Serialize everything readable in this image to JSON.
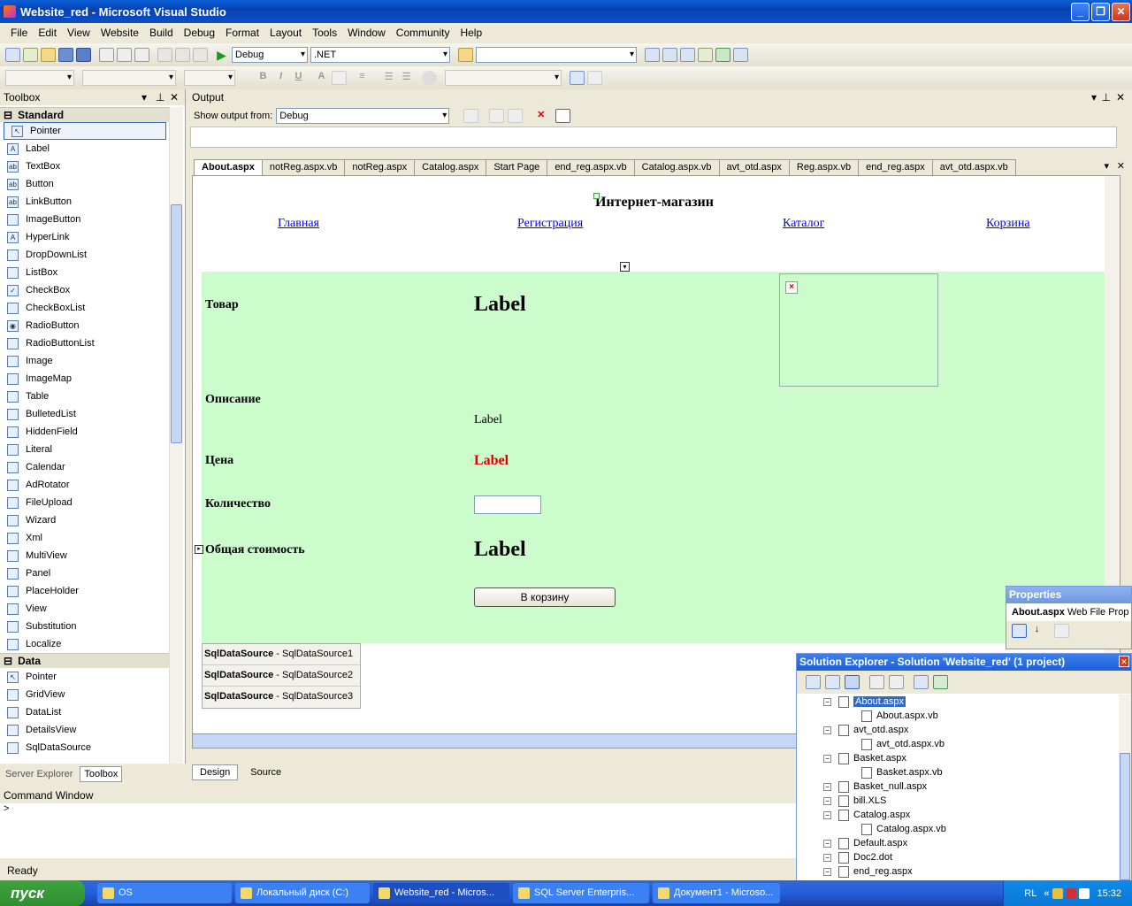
{
  "window": {
    "title": "Website_red - Microsoft Visual Studio"
  },
  "menu": [
    "File",
    "Edit",
    "View",
    "Website",
    "Build",
    "Debug",
    "Format",
    "Layout",
    "Tools",
    "Window",
    "Community",
    "Help"
  ],
  "toolbar": {
    "config": "Debug",
    "platform": ".NET"
  },
  "toolbox": {
    "title": "Toolbox",
    "categories": [
      {
        "name": "Standard",
        "items": [
          "Pointer",
          "Label",
          "TextBox",
          "Button",
          "LinkButton",
          "ImageButton",
          "HyperLink",
          "DropDownList",
          "ListBox",
          "CheckBox",
          "CheckBoxList",
          "RadioButton",
          "RadioButtonList",
          "Image",
          "ImageMap",
          "Table",
          "BulletedList",
          "HiddenField",
          "Literal",
          "Calendar",
          "AdRotator",
          "FileUpload",
          "Wizard",
          "Xml",
          "MultiView",
          "Panel",
          "PlaceHolder",
          "View",
          "Substitution",
          "Localize"
        ]
      },
      {
        "name": "Data",
        "items": [
          "Pointer",
          "GridView",
          "DataList",
          "DetailsView",
          "SqlDataSource"
        ]
      }
    ],
    "tabs": [
      "Server Explorer",
      "Toolbox"
    ]
  },
  "output": {
    "title": "Output",
    "show_from_label": "Show output from:",
    "show_from_value": "Debug"
  },
  "doc_tabs": [
    "About.aspx",
    "notReg.aspx.vb",
    "notReg.aspx",
    "Catalog.aspx",
    "Start Page",
    "end_reg.aspx.vb",
    "Catalog.aspx.vb",
    "avt_otd.aspx",
    "Reg.aspx.vb",
    "end_reg.aspx",
    "avt_otd.aspx.vb"
  ],
  "page": {
    "heading": "Интернет-магазин",
    "nav": [
      "Главная",
      "Регистрация",
      "Каталог",
      "Корзина"
    ],
    "fields": {
      "product": "Товар",
      "description": "Описание",
      "price": "Цена",
      "quantity": "Количество",
      "total": "Общая стоимость"
    },
    "labels": {
      "product_value": "Label",
      "description_value": "Label",
      "price_value": "Label",
      "total_value": "Label"
    },
    "add_button": "В корзину",
    "datasources": [
      {
        "type": "SqlDataSource",
        "name": " - SqlDataSource1"
      },
      {
        "type": "SqlDataSource",
        "name": " - SqlDataSource2"
      },
      {
        "type": "SqlDataSource",
        "name": " - SqlDataSource3"
      }
    ],
    "price_color": "#ff0000",
    "panel_color": "#ccfbcc"
  },
  "view_tabs": [
    "Design",
    "Source"
  ],
  "command_window": {
    "title": "Command Window",
    "prompt": ">"
  },
  "status": "Ready",
  "properties": {
    "title": "Properties",
    "object": "About.aspx",
    "type": "Web File Prop"
  },
  "solution": {
    "title": "Solution Explorer - Solution 'Website_red' (1 project)",
    "items": [
      {
        "name": "About.aspx",
        "level": 0,
        "sel": true
      },
      {
        "name": "About.aspx.vb",
        "level": 1
      },
      {
        "name": "avt_otd.aspx",
        "level": 0
      },
      {
        "name": "avt_otd.aspx.vb",
        "level": 1
      },
      {
        "name": "Basket.aspx",
        "level": 0
      },
      {
        "name": "Basket.aspx.vb",
        "level": 1
      },
      {
        "name": "Basket_null.aspx",
        "level": 0
      },
      {
        "name": "bill.XLS",
        "level": 0
      },
      {
        "name": "Catalog.aspx",
        "level": 0
      },
      {
        "name": "Catalog.aspx.vb",
        "level": 1
      },
      {
        "name": "Default.aspx",
        "level": 0
      },
      {
        "name": "Doc2.dot",
        "level": 0
      },
      {
        "name": "end_reg.aspx",
        "level": 0
      }
    ]
  },
  "taskbar": {
    "start": "пуск",
    "tasks": [
      "OS",
      "Локальный диск (C:)",
      "Website_red - Micros...",
      "SQL Server Enterpris...",
      "Документ1 - Microso..."
    ],
    "lang": "RL",
    "clock": "15:32"
  }
}
